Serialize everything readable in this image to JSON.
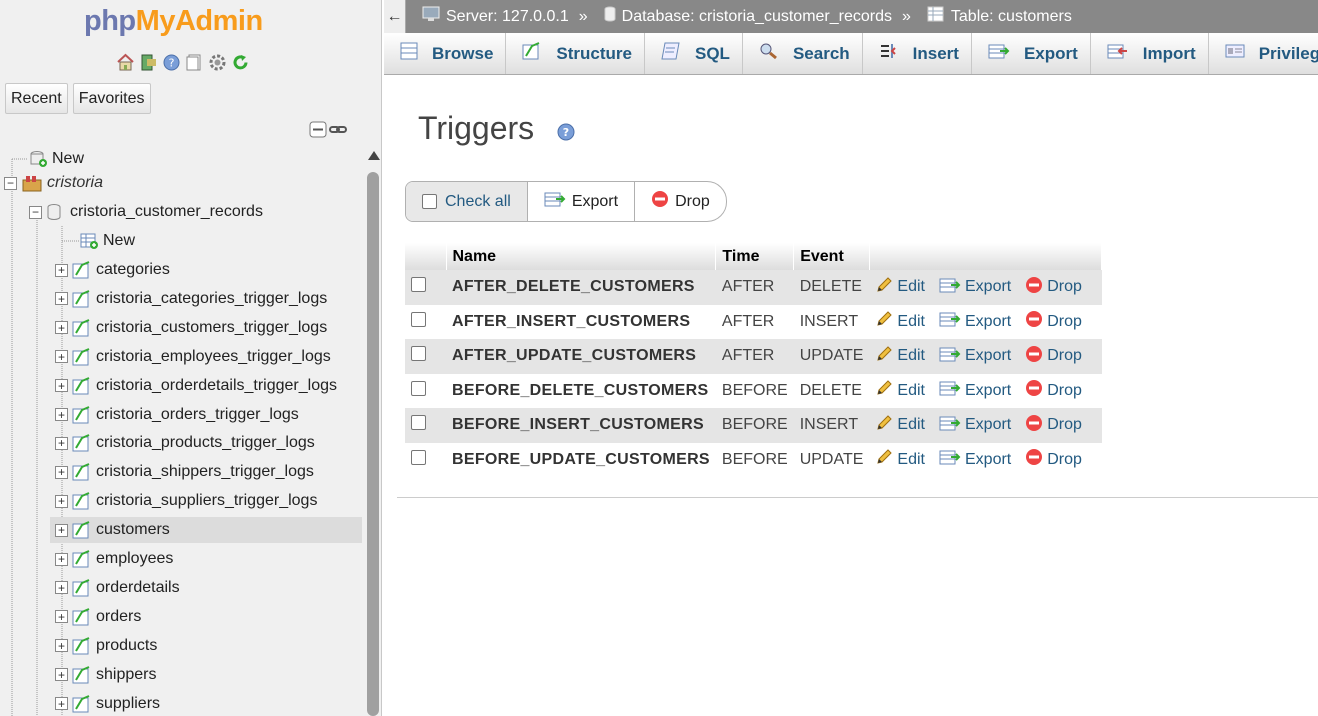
{
  "app": {
    "logo_php": "php",
    "logo_admin": "MyAdmin"
  },
  "sidebar": {
    "tabs": [
      "Recent",
      "Favorites"
    ],
    "tree": {
      "new_root": "New",
      "server_db": "cristoria",
      "database": "cristoria_customer_records",
      "new_table": "New",
      "tables": [
        "categories",
        "cristoria_categories_trigger_logs",
        "cristoria_customers_trigger_logs",
        "cristoria_employees_trigger_logs",
        "cristoria_orderdetails_trigger_logs",
        "cristoria_orders_trigger_logs",
        "cristoria_products_trigger_logs",
        "cristoria_shippers_trigger_logs",
        "cristoria_suppliers_trigger_logs",
        "customers",
        "employees",
        "orderdetails",
        "orders",
        "products",
        "shippers",
        "suppliers"
      ],
      "selected": "customers"
    }
  },
  "breadcrumb": {
    "server": "Server: 127.0.0.1",
    "database": "Database: cristoria_customer_records",
    "table": "Table: customers",
    "separator": "»"
  },
  "tabs": [
    "Browse",
    "Structure",
    "SQL",
    "Search",
    "Insert",
    "Export",
    "Import",
    "Privileges"
  ],
  "main": {
    "title": "Triggers",
    "actions": {
      "check_all": "Check all",
      "export": "Export",
      "drop": "Drop"
    },
    "columns": [
      "Name",
      "Time",
      "Event"
    ],
    "row_actions": {
      "edit": "Edit",
      "export": "Export",
      "drop": "Drop"
    },
    "triggers": [
      {
        "name": "AFTER_DELETE_CUSTOMERS",
        "time": "AFTER",
        "event": "DELETE"
      },
      {
        "name": "AFTER_INSERT_CUSTOMERS",
        "time": "AFTER",
        "event": "INSERT"
      },
      {
        "name": "AFTER_UPDATE_CUSTOMERS",
        "time": "AFTER",
        "event": "UPDATE"
      },
      {
        "name": "BEFORE_DELETE_CUSTOMERS",
        "time": "BEFORE",
        "event": "DELETE"
      },
      {
        "name": "BEFORE_INSERT_CUSTOMERS",
        "time": "BEFORE",
        "event": "INSERT"
      },
      {
        "name": "BEFORE_UPDATE_CUSTOMERS",
        "time": "BEFORE",
        "event": "UPDATE"
      }
    ]
  },
  "colors": {
    "link": "#235a81",
    "topbar": "#888888",
    "logo_php": "#6c78af",
    "logo_admin": "#f89c1c"
  }
}
